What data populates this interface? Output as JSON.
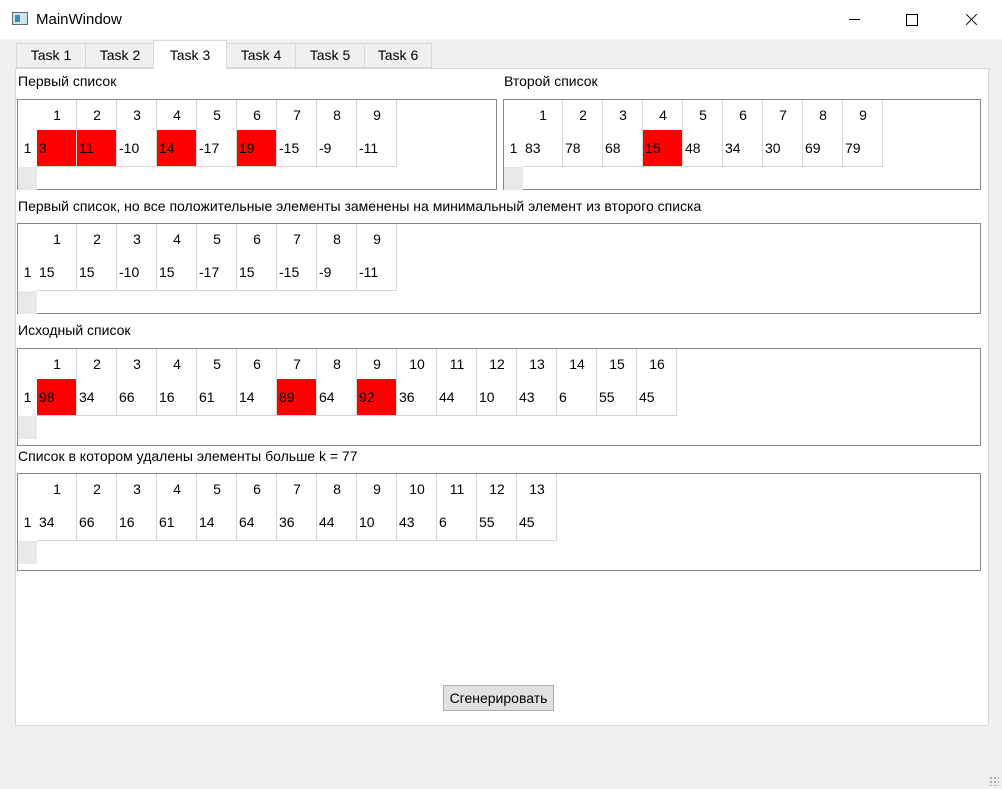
{
  "window": {
    "title": "MainWindow",
    "app_icon": "app-window-icon",
    "controls": {
      "minimize_icon": "minimize-icon",
      "maximize_icon": "maximize-icon",
      "close_icon": "close-icon"
    }
  },
  "tabs": [
    {
      "label": "Task 1",
      "active": false
    },
    {
      "label": "Task 2",
      "active": false
    },
    {
      "label": "Task 3",
      "active": true
    },
    {
      "label": "Task 4",
      "active": false
    },
    {
      "label": "Task 5",
      "active": false
    },
    {
      "label": "Task 6",
      "active": false
    }
  ],
  "highlight_color": "#ff0000",
  "grids": [
    {
      "label": "Первый список",
      "row_header": "1",
      "columns": [
        "1",
        "2",
        "3",
        "4",
        "5",
        "6",
        "7",
        "8",
        "9"
      ],
      "values": [
        "3",
        "11",
        "-10",
        "14",
        "-17",
        "19",
        "-15",
        "-9",
        "-11"
      ],
      "highlighted": [
        true,
        true,
        false,
        true,
        false,
        true,
        false,
        false,
        false
      ]
    },
    {
      "label": "Второй список",
      "row_header": "1",
      "columns": [
        "1",
        "2",
        "3",
        "4",
        "5",
        "6",
        "7",
        "8",
        "9"
      ],
      "values": [
        "83",
        "78",
        "68",
        "15",
        "48",
        "34",
        "30",
        "69",
        "79"
      ],
      "highlighted": [
        false,
        false,
        false,
        true,
        false,
        false,
        false,
        false,
        false
      ]
    },
    {
      "label": "Первый список, но все положительные элементы заменены на минимальный элемент из второго списка",
      "row_header": "1",
      "columns": [
        "1",
        "2",
        "3",
        "4",
        "5",
        "6",
        "7",
        "8",
        "9"
      ],
      "values": [
        "15",
        "15",
        "-10",
        "15",
        "-17",
        "15",
        "-15",
        "-9",
        "-11"
      ],
      "highlighted": [
        false,
        false,
        false,
        false,
        false,
        false,
        false,
        false,
        false
      ]
    },
    {
      "label": "Исходный список",
      "row_header": "1",
      "columns": [
        "1",
        "2",
        "3",
        "4",
        "5",
        "6",
        "7",
        "8",
        "9",
        "10",
        "11",
        "12",
        "13",
        "14",
        "15",
        "16"
      ],
      "values": [
        "98",
        "34",
        "66",
        "16",
        "61",
        "14",
        "89",
        "64",
        "92",
        "36",
        "44",
        "10",
        "43",
        "6",
        "55",
        "45"
      ],
      "highlighted": [
        true,
        false,
        false,
        false,
        false,
        false,
        true,
        false,
        true,
        false,
        false,
        false,
        false,
        false,
        false,
        false
      ]
    },
    {
      "label": "Список в котором удалены элементы больше k = 77",
      "row_header": "1",
      "columns": [
        "1",
        "2",
        "3",
        "4",
        "5",
        "6",
        "7",
        "8",
        "9",
        "10",
        "11",
        "12",
        "13"
      ],
      "values": [
        "34",
        "66",
        "16",
        "61",
        "14",
        "64",
        "36",
        "44",
        "10",
        "43",
        "6",
        "55",
        "45"
      ],
      "highlighted": [
        false,
        false,
        false,
        false,
        false,
        false,
        false,
        false,
        false,
        false,
        false,
        false,
        false
      ]
    }
  ],
  "generate_button": {
    "label": "Сгенерировать"
  }
}
